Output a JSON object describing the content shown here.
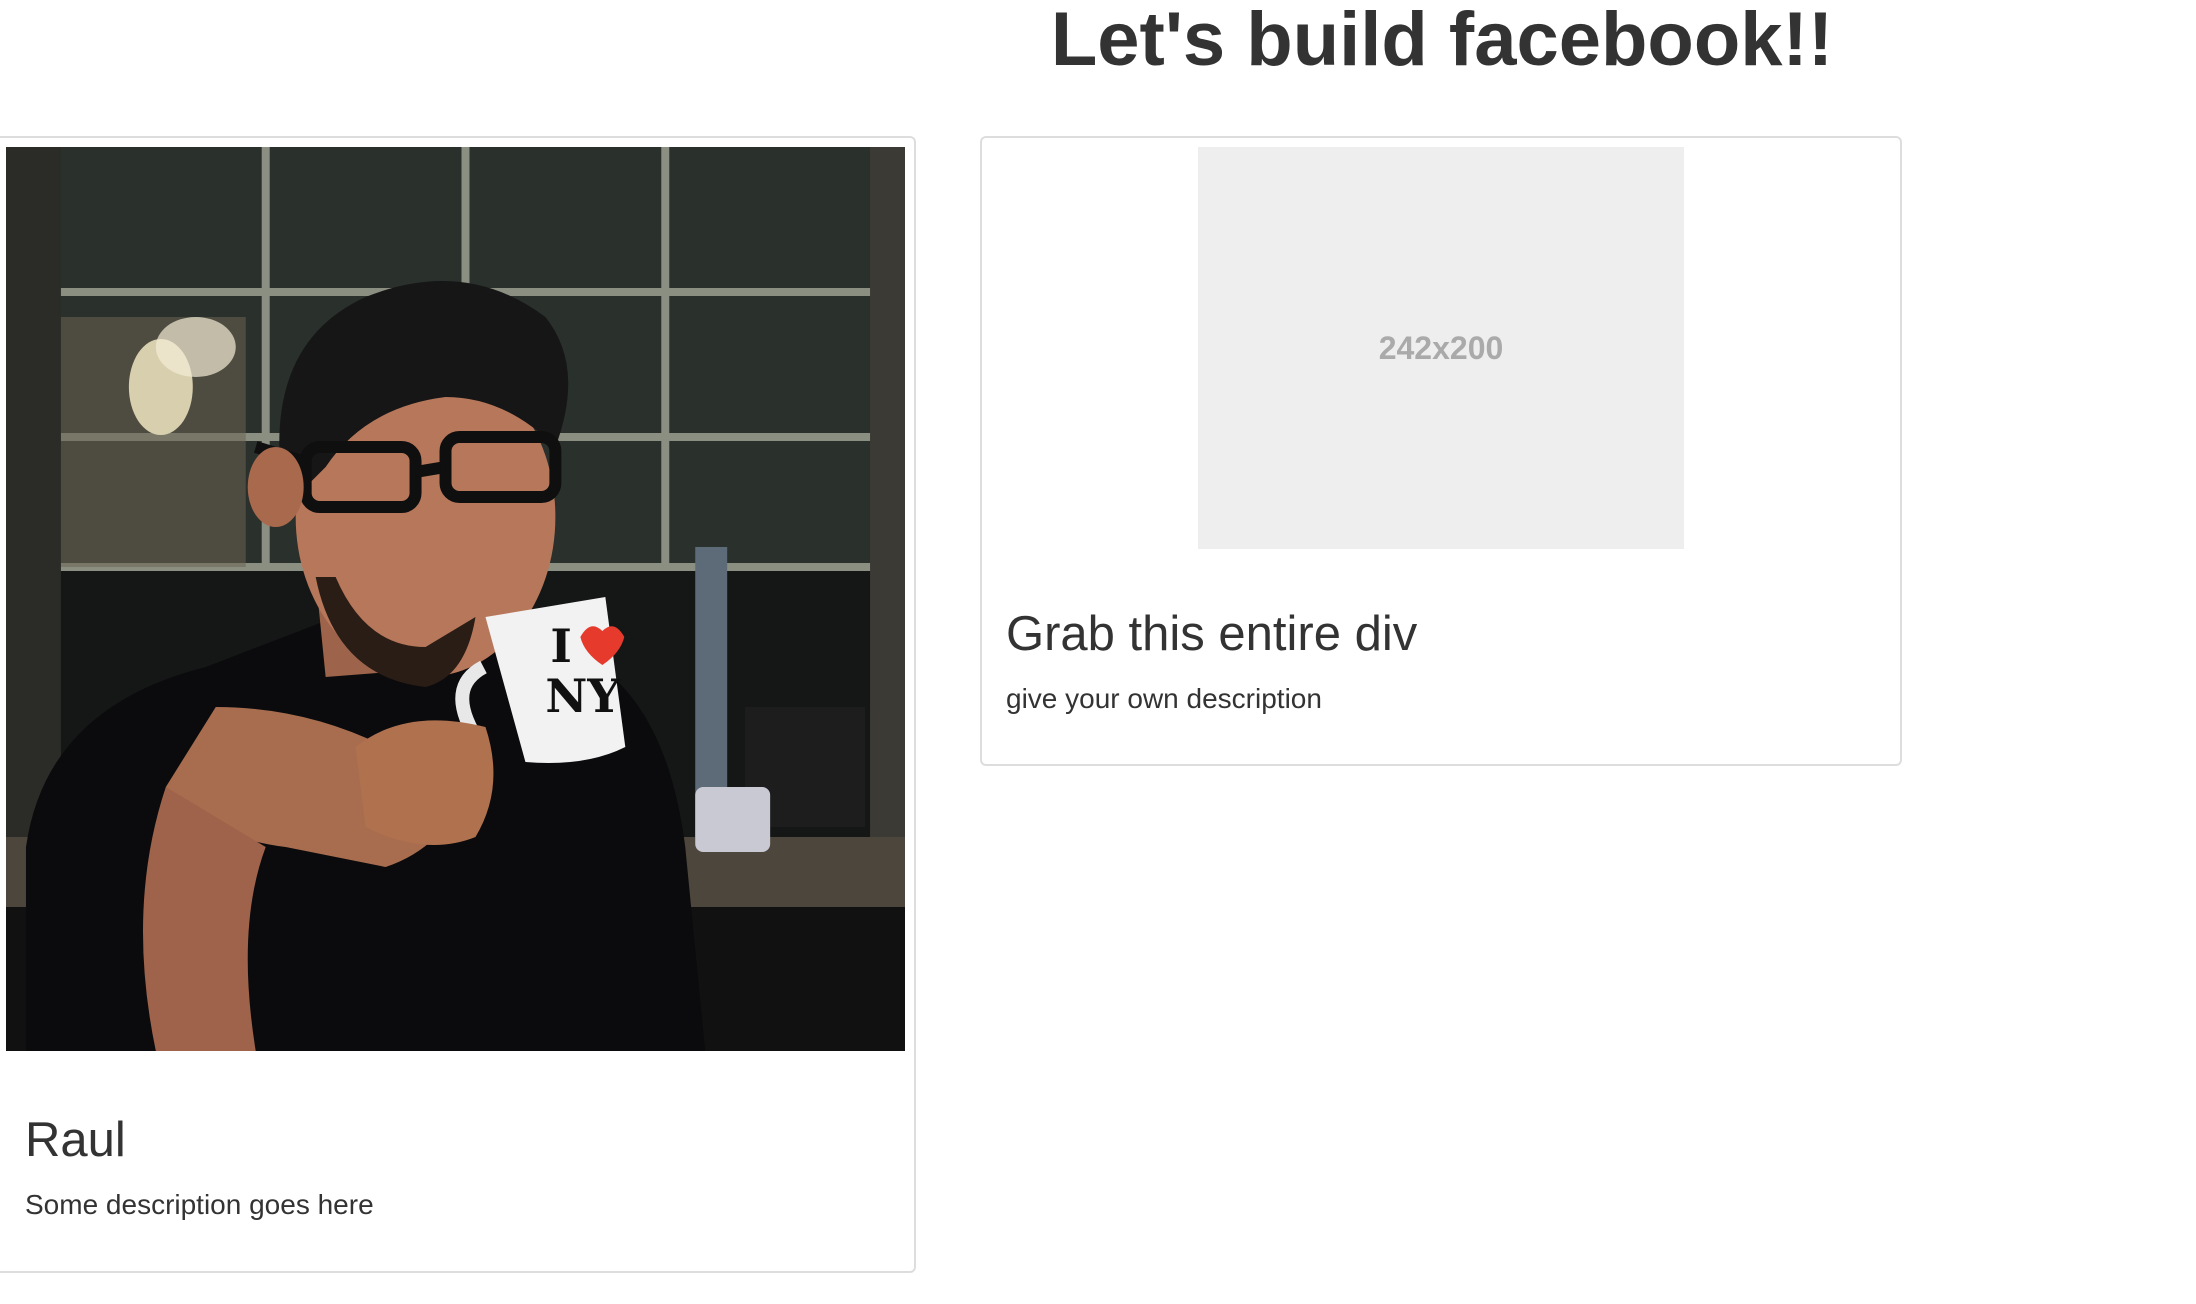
{
  "header": {
    "title": "Let's build facebook!!"
  },
  "cards": [
    {
      "name": "Raul",
      "description": "Some description goes here"
    },
    {
      "placeholder": "242x200",
      "name": "Grab this entire div",
      "description": "give your own description"
    }
  ],
  "colors": {
    "text": "#333333",
    "card_border": "#dddddd",
    "placeholder_bg": "#eeeeee",
    "placeholder_text": "#aaaaaa"
  }
}
